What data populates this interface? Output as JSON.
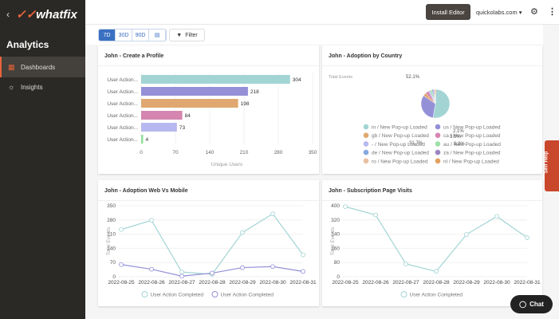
{
  "sidebar": {
    "brand": "whatfix",
    "section": "Analytics",
    "items": [
      {
        "label": "Dashboards",
        "icon": "dashboard-icon",
        "active": true
      },
      {
        "label": "Insights",
        "icon": "lightbulb-icon"
      }
    ]
  },
  "topbar": {
    "install_label": "Install Editor",
    "domain": "quickolabs.com"
  },
  "toolbar": {
    "ranges": [
      "7D",
      "30D",
      "90D"
    ],
    "selected": "7D",
    "filter_label": "Filter"
  },
  "self_help": "Self Help",
  "chat_label": "Chat",
  "accent": "#3a70c2",
  "chart_data": [
    {
      "title": "John - Create a Profile",
      "type": "bar",
      "orientation": "horizontal",
      "categories": [
        "User Action...",
        "User Action...",
        "User Action...",
        "User Action...",
        "User Action...",
        "User Action..."
      ],
      "values": [
        304,
        218,
        198,
        84,
        73,
        4
      ],
      "colors": [
        "#a3d4d4",
        "#9490d8",
        "#e0a870",
        "#d585b0",
        "#b8b8f0",
        "#8ee09a"
      ],
      "xlabel": "Unique Users",
      "xticks": [
        0,
        70,
        140,
        210,
        280,
        350
      ],
      "xlim": [
        0,
        350
      ]
    },
    {
      "title": "John - Adoption by Country",
      "type": "pie",
      "ylabel": "Total Events",
      "slices": [
        {
          "label": "in / New Pop-up Loaded",
          "value": 52.1,
          "color": "#a3d4d4"
        },
        {
          "label": "us / New Pop-up Loaded",
          "value": 31.7,
          "color": "#9490d8"
        },
        {
          "label": "gb / New Pop-up Loaded",
          "value": 3.8,
          "color": "#e0a870"
        },
        {
          "label": "ca / New Pop-up Loaded",
          "value": 3.6,
          "color": "#d585b0"
        },
        {
          "label": "- / New Pop-up Loaded",
          "value": 2.1,
          "color": "#b8b8f0"
        },
        {
          "label": "au / New Pop-up Loaded",
          "value": 2.0,
          "color": "#9ee0a8"
        },
        {
          "label": "de / New Pop-up Loaded",
          "value": 1.5,
          "color": "#85a8e0"
        },
        {
          "label": "za / New Pop-up Loaded",
          "value": 1.2,
          "color": "#9a85c0"
        },
        {
          "label": "ro / New Pop-up Loaded",
          "value": 1.0,
          "color": "#e8c0a0"
        },
        {
          "label": "nl / New Pop-up Loaded",
          "value": 1.0,
          "color": "#e0a060"
        }
      ],
      "data_labels": [
        "52.1%",
        "31.7%",
        "3.8%",
        "3.6%",
        "2.1%"
      ]
    },
    {
      "title": "John - Adoption Web Vs Mobile",
      "type": "line",
      "ylabel": "Total Events",
      "x": [
        "2022-08-25",
        "2022-08-26",
        "2022-08-27",
        "2022-08-28",
        "2022-08-29",
        "2022-08-30",
        "2022-08-31"
      ],
      "yticks": [
        0,
        70,
        140,
        210,
        280,
        350
      ],
      "ylim": [
        0,
        350
      ],
      "series": [
        {
          "name": "User Action Completed",
          "color": "#a3d4d4",
          "values": [
            233,
            278,
            23,
            12,
            218,
            310,
            108
          ]
        },
        {
          "name": "User Action Completed",
          "color": "#9490d8",
          "values": [
            60,
            37,
            3,
            18,
            45,
            50,
            26
          ]
        }
      ]
    },
    {
      "title": "John - Subscription Page Visits",
      "type": "line",
      "ylabel": "Total Events",
      "x": [
        "2022-08-25",
        "2022-08-26",
        "2022-08-27",
        "2022-08-28",
        "2022-08-29",
        "2022-08-30",
        "2022-08-31"
      ],
      "yticks": [
        0,
        80,
        160,
        240,
        320,
        400
      ],
      "ylim": [
        0,
        400
      ],
      "series": [
        {
          "name": "User Action Completed",
          "color": "#a3d4d4",
          "values": [
            395,
            348,
            72,
            30,
            238,
            340,
            220
          ]
        }
      ]
    }
  ]
}
